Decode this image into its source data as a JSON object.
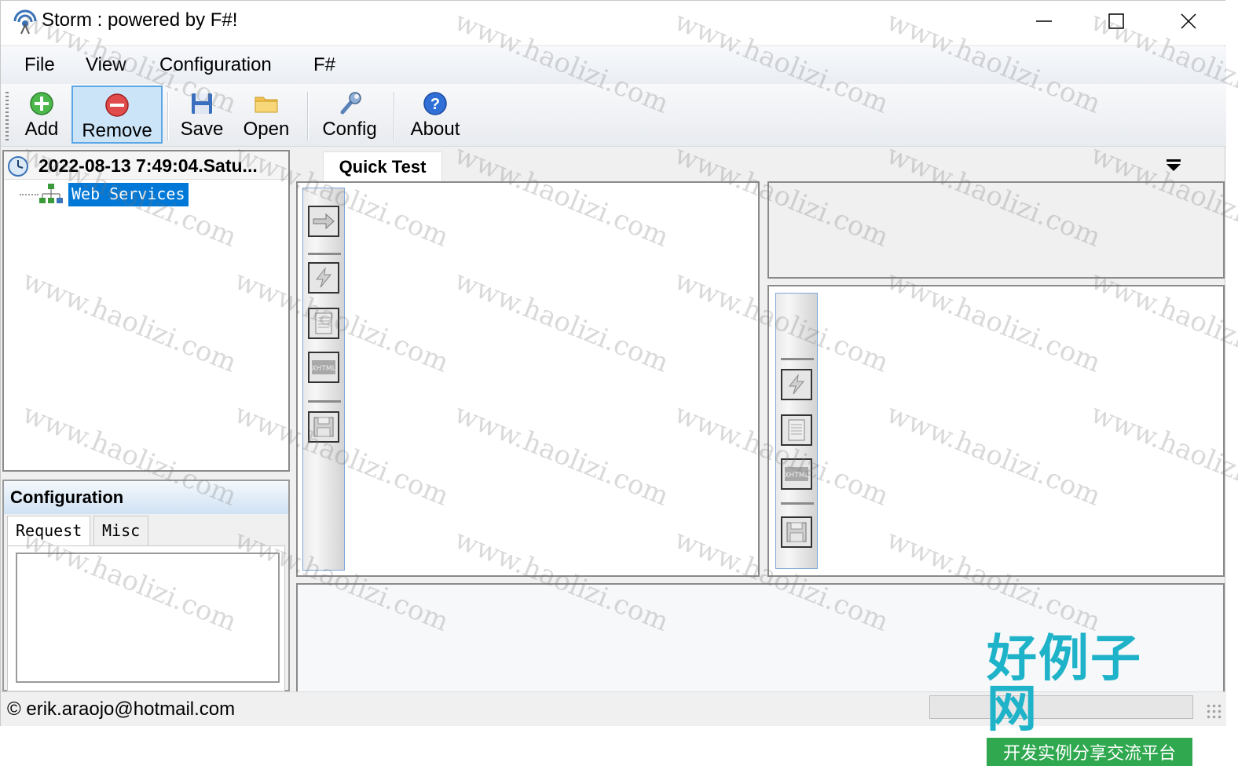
{
  "window": {
    "title": "Storm : powered by F#!"
  },
  "menu": {
    "items": [
      "File",
      "View",
      "Configuration",
      "F#"
    ]
  },
  "toolbar": {
    "add": "Add",
    "remove": "Remove",
    "save": "Save",
    "open": "Open",
    "config": "Config",
    "about": "About"
  },
  "tree": {
    "header": "2022-08-13 7:49:04.Satu...",
    "node": "Web Services"
  },
  "config_panel": {
    "title": "Configuration",
    "tabs": [
      "Request",
      "Misc"
    ]
  },
  "tabs": {
    "quick_test": "Quick Test"
  },
  "status": {
    "text": "© erik.araojo@hotmail.com"
  },
  "watermark": {
    "text": "www.haolizi.com",
    "brand_main": "好例子网",
    "brand_sub": "开发实例分享交流平台"
  },
  "colors": {
    "selection": "#0078d7",
    "active_button": "#cce4f7",
    "brand": "#1eb3c8",
    "brand_bar": "#2fa84f"
  }
}
